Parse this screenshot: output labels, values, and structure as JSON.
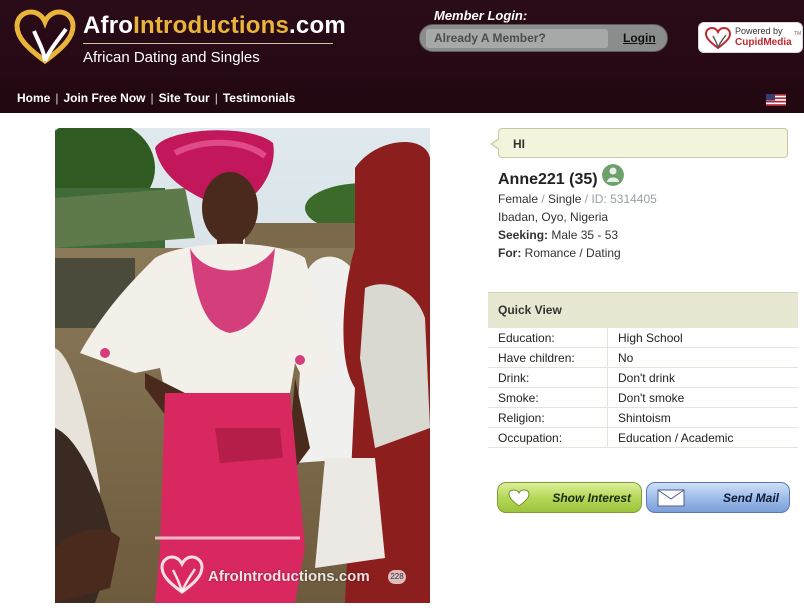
{
  "header": {
    "brand_prefix": "Afro",
    "brand_middle": "Introductions",
    "brand_suffix": ".com",
    "tagline": "African Dating and Singles",
    "login_title": "Member Login:",
    "login_placeholder": "Already A Member?",
    "login_link": "Login",
    "powered_by": "Powered by",
    "cupid_brand": "CupidMedia",
    "cupid_tm": "TM",
    "flag_icon": "us-flag-icon",
    "logo_icon": "heart-logo-icon",
    "colors": {
      "header_bg": "#260914",
      "brand_accent": "#e8b43c"
    }
  },
  "nav": {
    "items": [
      {
        "label": "Home"
      },
      {
        "label": "Join Free Now"
      },
      {
        "label": "Site Tour"
      },
      {
        "label": "Testimonials"
      }
    ],
    "separator": "|"
  },
  "photo": {
    "watermark_text": "AfroIntroductions.com",
    "watermark_count": "228"
  },
  "profile": {
    "greeting": "HI",
    "name": "Anne221 (35)",
    "gender": "Female",
    "status": "Single",
    "divider": "/",
    "id_label": "ID: 5314405",
    "location": "Ibadan, Oyo, Nigeria",
    "seeking_label": "Seeking:",
    "seeking_value": "Male 35 - 53",
    "for_label": "For:",
    "for_value": "Romance / Dating",
    "online_icon": "person-status-icon"
  },
  "quick_view": {
    "title": "Quick View",
    "rows": [
      {
        "label": "Education:",
        "value": "High School"
      },
      {
        "label": "Have children:",
        "value": "No"
      },
      {
        "label": "Drink:",
        "value": "Don't drink"
      },
      {
        "label": "Smoke:",
        "value": "Don't smoke"
      },
      {
        "label": "Religion:",
        "value": "Shintoism"
      },
      {
        "label": "Occupation:",
        "value": "Education / Academic"
      }
    ]
  },
  "actions": {
    "interest_label": "Show Interest",
    "interest_icon": "heart-icon",
    "mail_label": "Send Mail",
    "mail_icon": "envelope-icon"
  }
}
